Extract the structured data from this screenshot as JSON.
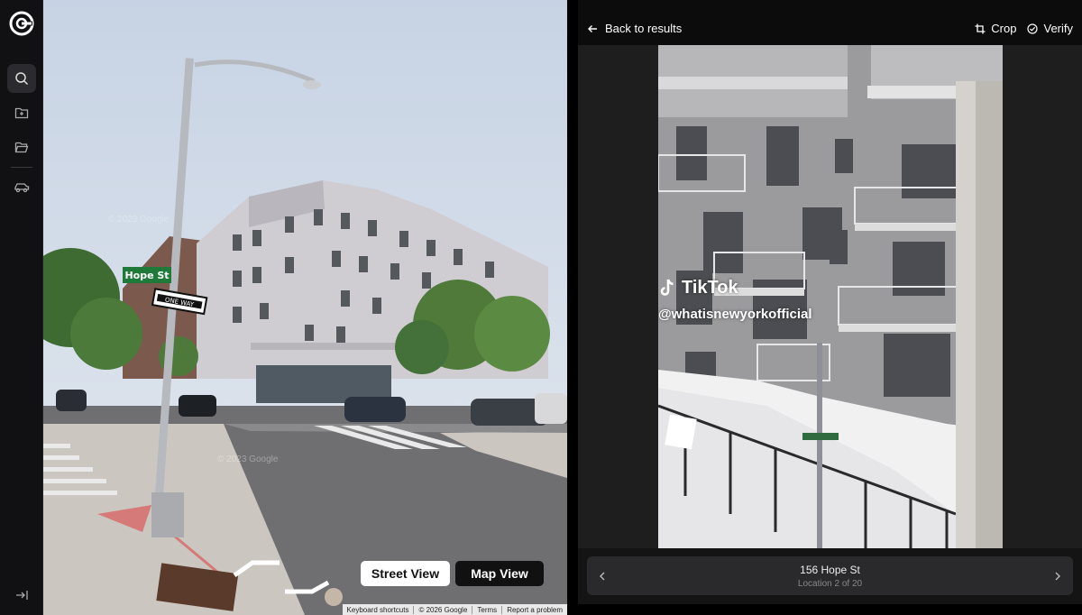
{
  "header": {
    "back_label": "Back to results",
    "crop_label": "Crop",
    "verify_label": "Verify"
  },
  "sidebar": {
    "items": [
      {
        "icon": "search-icon",
        "active": true
      },
      {
        "icon": "folder-plus-icon",
        "active": false
      },
      {
        "icon": "folder-open-icon",
        "active": false
      },
      {
        "icon": "car-icon",
        "active": false
      }
    ],
    "collapse_icon": "collapse-sidebar-icon"
  },
  "street_view": {
    "street_view_button": "Street View",
    "map_view_button": "Map View",
    "street_sign": "Hope St",
    "oneway_sign": "ONE WAY",
    "watermark": "© 2023 Google",
    "footer_links": [
      "Keyboard shortcuts",
      "© 2026 Google",
      "Terms",
      "Report a problem"
    ]
  },
  "photo": {
    "tiktok_brand": "TikTok",
    "tiktok_handle": "@whatisnewyorkofficial"
  },
  "location": {
    "name": "156 Hope St",
    "position_text": "Location 2 of 20"
  },
  "colors": {
    "sidebar_bg": "#111113",
    "panel_bg": "#1e1e1e",
    "pill_light": "#ffffff",
    "pill_dark": "#111111"
  }
}
